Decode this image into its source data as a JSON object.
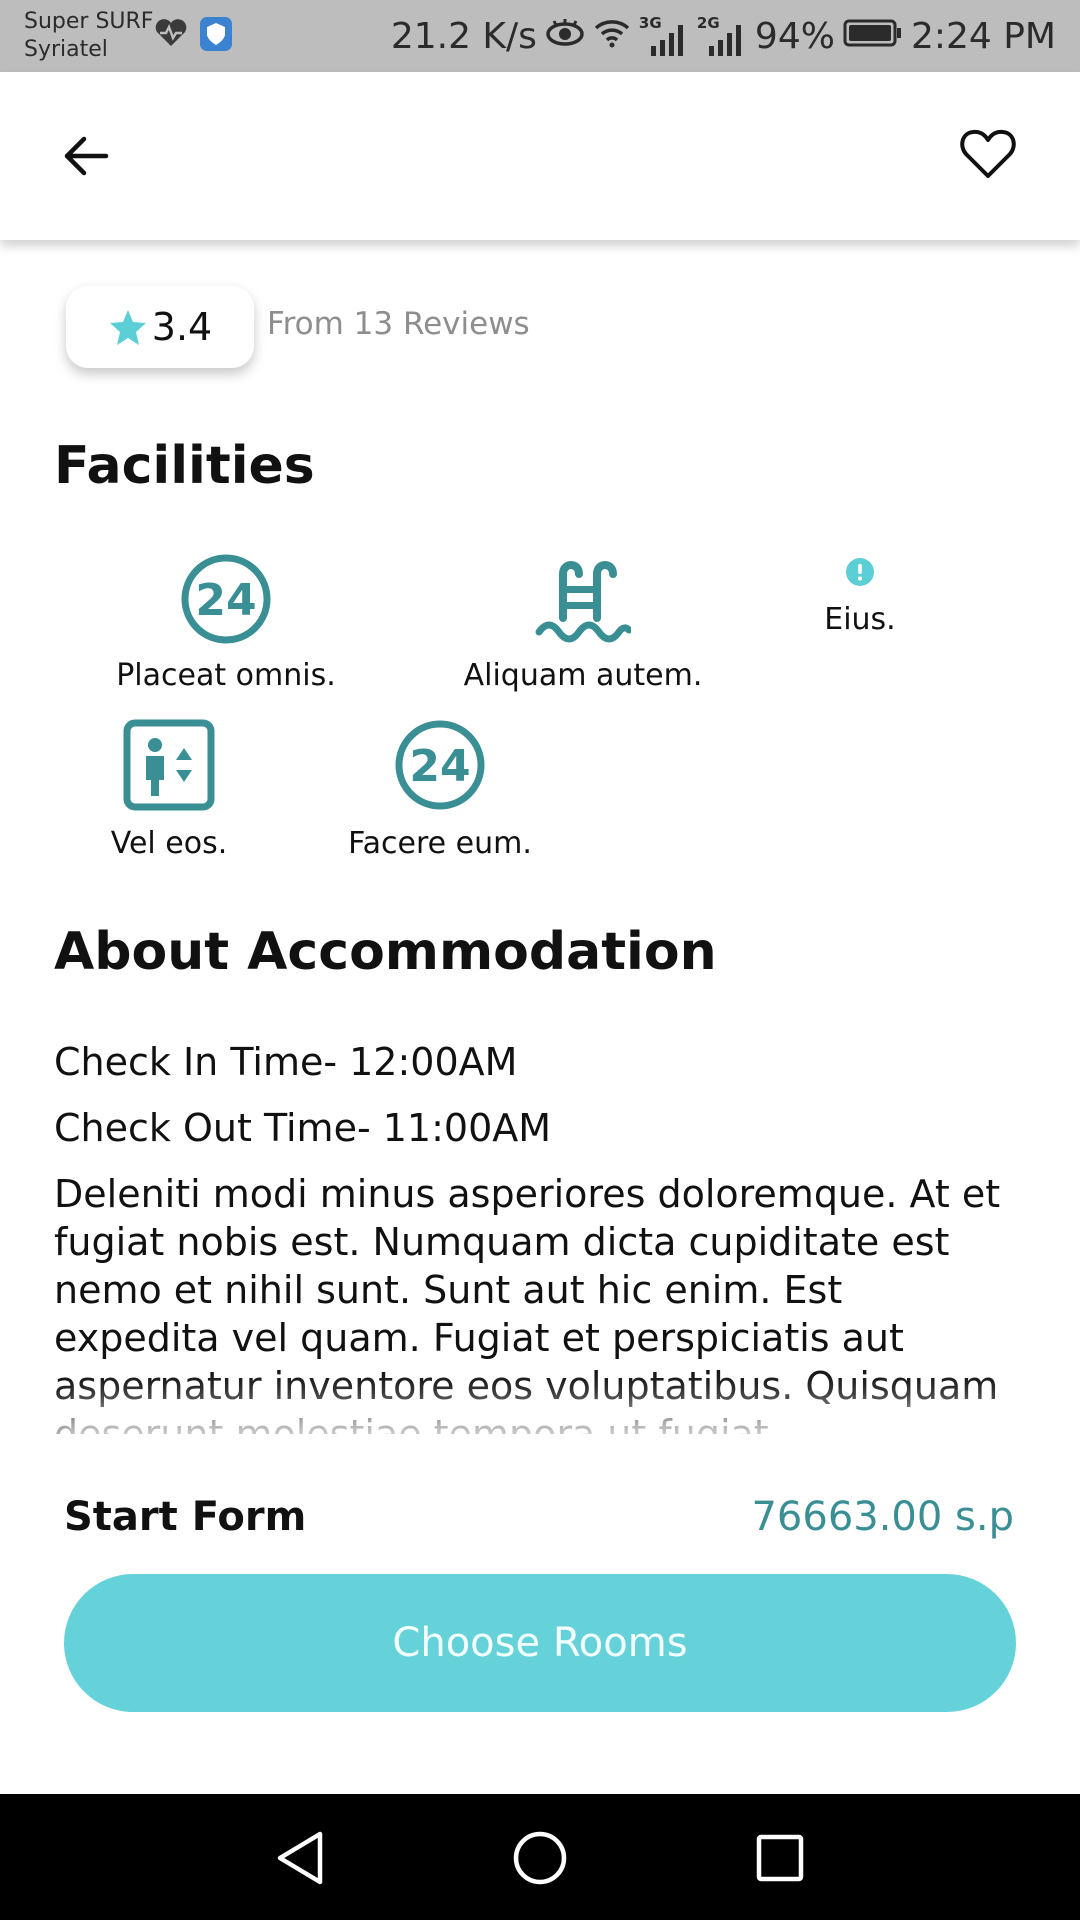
{
  "status_bar": {
    "carrier_line1": "Super SURF",
    "carrier_line2": "Syriatel",
    "speed": "21.2 K/s",
    "net1": "3G",
    "net2": "2G",
    "battery": "94%",
    "time": "2:24 PM"
  },
  "rating": {
    "value": "3.4",
    "reviews": "From 13 Reviews"
  },
  "facilities": {
    "title": "Facilities",
    "items": [
      {
        "label": "Placeat omnis.",
        "icon": "24-hours-icon"
      },
      {
        "label": "Aliquam autem.",
        "icon": "pool-icon"
      },
      {
        "label": "Eius.",
        "icon": "info-dot-icon"
      },
      {
        "label": "Vel eos.",
        "icon": "elevator-icon"
      },
      {
        "label": "Facere eum.",
        "icon": "24-hours-icon"
      }
    ]
  },
  "about": {
    "title": "About Accommodation",
    "check_in": "Check In Time- 12:00AM",
    "check_out": "Check Out Time- 11:00AM",
    "description": "Deleniti modi minus asperiores doloremque. At et fugiat nobis est. Numquam dicta cupiditate est nemo et nihil sunt. Sunt aut hic enim. Est expedita vel quam. Fugiat et perspiciatis aut aspernatur inventore eos voluptatibus. Quisquam deserunt molestiae tempora ut fugiat"
  },
  "booking": {
    "start_label": "Start Form",
    "price": "76663.00 s.p",
    "button_label": "Choose Rooms"
  },
  "colors": {
    "accent": "#65d2d9",
    "icon_teal": "#3a8f94",
    "status_bar": "#bdbdbd"
  }
}
